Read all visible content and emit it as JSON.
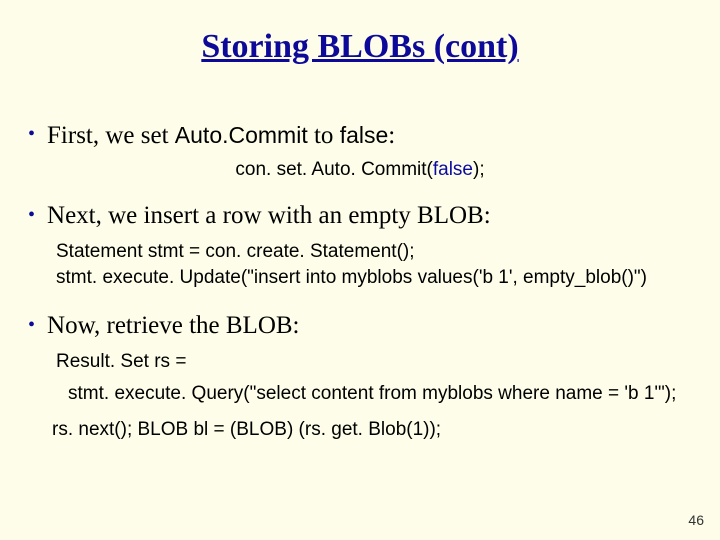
{
  "title": "Storing BLOBs (cont)",
  "b1": {
    "pre": "First, we set ",
    "ac": "Auto.Commit",
    "mid": " to ",
    "f": "false",
    "post": ":"
  },
  "c1": {
    "pre": "con. set. Auto. Commit(",
    "f": "false",
    "post": ");"
  },
  "b2": "Next, we insert a row with an empty BLOB:",
  "c2a": "Statement stmt = con. create. Statement();",
  "c2b": "stmt. execute. Update(\"insert into myblobs values('b 1', empty_blob()\")",
  "b3": "Now, retrieve the BLOB:",
  "c3a": "Result. Set rs =",
  "c3b": "stmt. execute. Query(\"select content from myblobs where name = 'b 1'\");",
  "c3c": "rs. next();  BLOB bl = (BLOB) (rs. get. Blob(1));",
  "page": "46"
}
